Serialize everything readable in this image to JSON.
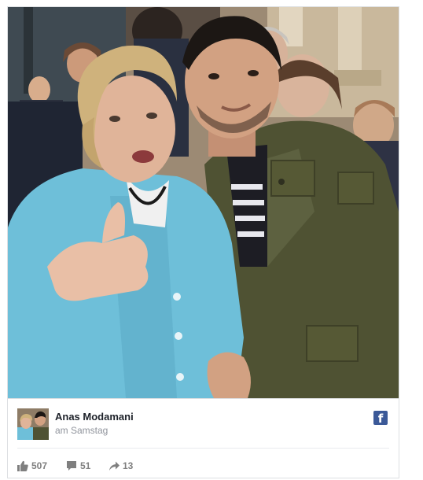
{
  "post": {
    "author": "Anas Modamani",
    "time": "am Samstag",
    "stats": {
      "likes": "507",
      "comments": "51",
      "shares": "13"
    }
  },
  "icons": {
    "brand": "facebook-logo-icon",
    "likes": "thumbs-up-icon",
    "comments": "speech-bubble-icon",
    "shares": "share-arrow-icon"
  },
  "colors": {
    "brand": "#3b5998",
    "stat_text": "#7f7f7f",
    "author_text": "#1d2129",
    "time_text": "#90949c"
  }
}
